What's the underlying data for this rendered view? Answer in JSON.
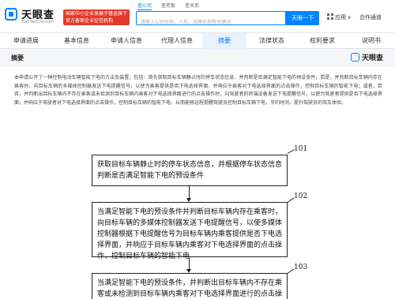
{
  "header": {
    "logo_name": "天眼查",
    "logo_domain": "TianYanCha.com",
    "badge_line1": "国家中小企业发展子基金旗下",
    "badge_line2": "官方备案企业征信机构",
    "search_tabs": [
      "查公司",
      "查老板",
      "查关系"
    ],
    "search_placeholder": "请输入公司名称、人名、品牌名称等关键词",
    "search_button": "天眼一下",
    "app_menu": "应用",
    "coop_link": "合作通道"
  },
  "tabs": {
    "items": [
      "申请进展",
      "基本信息",
      "申请人信息",
      "代理人信息",
      "摘要",
      "法律状态",
      "权利要求",
      "说明书"
    ],
    "active_index": 4
  },
  "section": {
    "title": "摘要",
    "watermark": "天眼查"
  },
  "abstract": {
    "text": "本申请公开了一种控制电动车辆智能下电的方法及装置，包括：首先获取目标车辆静止时的停车状态信息，并判断是否满足智能下电的预设条件；若是，并判断目标车辆内存在乘客时，向目标车辆的多媒体控制器发送下电提醒信号，以使为乘客提供是否下电选择界面，并响应于乘客对下电选择界面的点击操作，控制目标车辆的智能下电；或者，若否，并判断出目标车辆内不存在乘客或未检测到目标车辆内乘客对下电选择界面进行的点击操作时，向驾驶者的终端设备发送下电提醒信号，以使为驾驶者提供是否下电选择界面，并响应于驾驶者对下电选择界面的点击操作，控制目标车辆的智能下电，从而能够远程提醒驾驶员控制目标车辆下电，节约时间，提升驾驶员的驾车体验。"
  },
  "figure": {
    "steps": [
      {
        "label": "101",
        "text": "获取目标车辆静止时的停车状态信息，并根据停车状态信息判断是否满足智能下电的预设条件"
      },
      {
        "label": "102",
        "text": "当满足智能下电的预设条件并判断目标车辆内存在乘客时，向目标车辆的多媒体控制器发送下电提醒信号，以使多媒体控制器根据下电提醒信号为目标车辆内乘客提供是否下电选择界面，并响应于目标车辆内乘客对下电选择界面的点击操作，控制目标车辆的智能下电"
      },
      {
        "label": "103",
        "text": "当满足智能下电的预设条件，并判断出目标车辆内不存在乘客或未检测到目标车辆内乘客对下电选择界面进行的点击操作时"
      }
    ]
  }
}
